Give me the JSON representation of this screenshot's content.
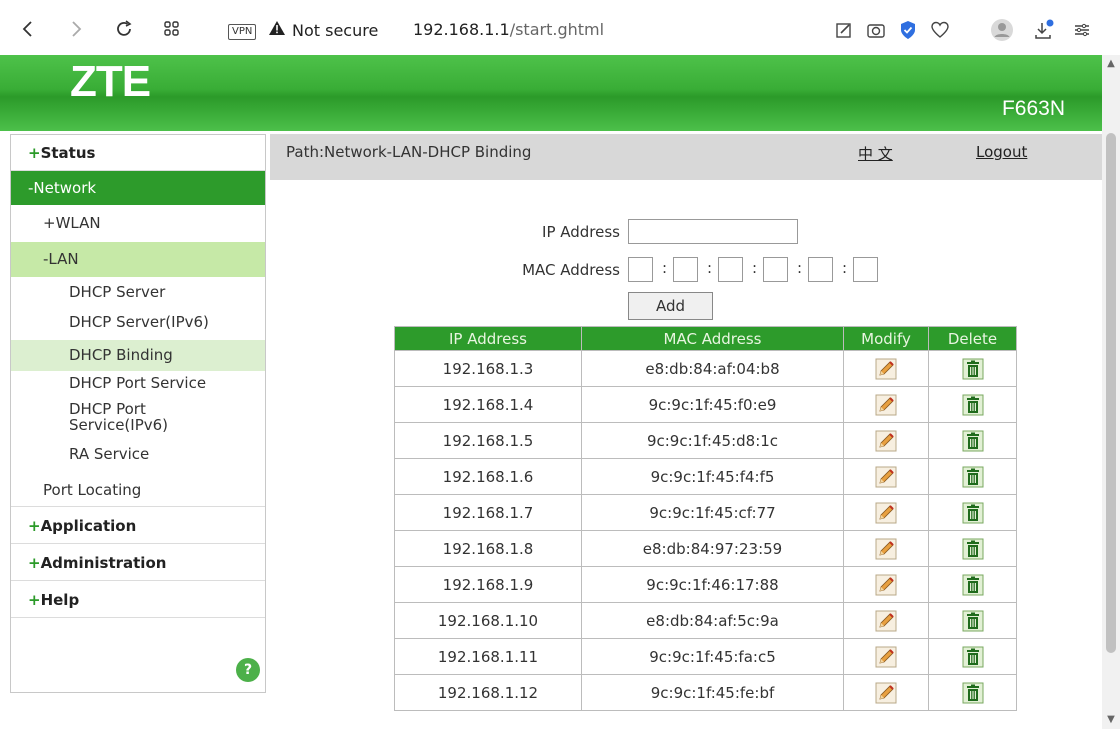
{
  "browser": {
    "vpn": "VPN",
    "security_text": "Not secure",
    "url_host": "192.168.1.1",
    "url_path": "/start.ghtml"
  },
  "header": {
    "logo": "ZTE",
    "model": "F663N"
  },
  "sidebar": {
    "status": "Status",
    "network": "-Network",
    "wlan": "+WLAN",
    "lan": "-LAN",
    "items": [
      "DHCP Server",
      "DHCP Server(IPv6)",
      "DHCP Binding",
      "DHCP Port Service",
      "DHCP Port Service(IPv6)",
      "RA Service"
    ],
    "port_locating": "Port Locating",
    "application": "Application",
    "administration": "Administration",
    "help": "Help",
    "help_icon": "?"
  },
  "content": {
    "path": "Path:Network-LAN-DHCP Binding",
    "lang": "中 文",
    "logout": "Logout",
    "ip_label": "IP Address",
    "mac_label": "MAC Address",
    "add_label": "Add",
    "ip_value": "",
    "mac_values": [
      "",
      "",
      "",
      "",
      "",
      ""
    ]
  },
  "table": {
    "headers": [
      "IP Address",
      "MAC Address",
      "Modify",
      "Delete"
    ],
    "rows": [
      {
        "ip": "192.168.1.3",
        "mac": "e8:db:84:af:04:b8"
      },
      {
        "ip": "192.168.1.4",
        "mac": "9c:9c:1f:45:f0:e9"
      },
      {
        "ip": "192.168.1.5",
        "mac": "9c:9c:1f:45:d8:1c"
      },
      {
        "ip": "192.168.1.6",
        "mac": "9c:9c:1f:45:f4:f5"
      },
      {
        "ip": "192.168.1.7",
        "mac": "9c:9c:1f:45:cf:77"
      },
      {
        "ip": "192.168.1.8",
        "mac": "e8:db:84:97:23:59"
      },
      {
        "ip": "192.168.1.9",
        "mac": "9c:9c:1f:46:17:88"
      },
      {
        "ip": "192.168.1.10",
        "mac": "e8:db:84:af:5c:9a"
      },
      {
        "ip": "192.168.1.11",
        "mac": "9c:9c:1f:45:fa:c5"
      },
      {
        "ip": "192.168.1.12",
        "mac": "9c:9c:1f:45:fe:bf"
      }
    ]
  },
  "colors": {
    "brand_green": "#2d9b2b",
    "active_lan": "#c6e9a7",
    "active_item": "#dcefd0"
  }
}
